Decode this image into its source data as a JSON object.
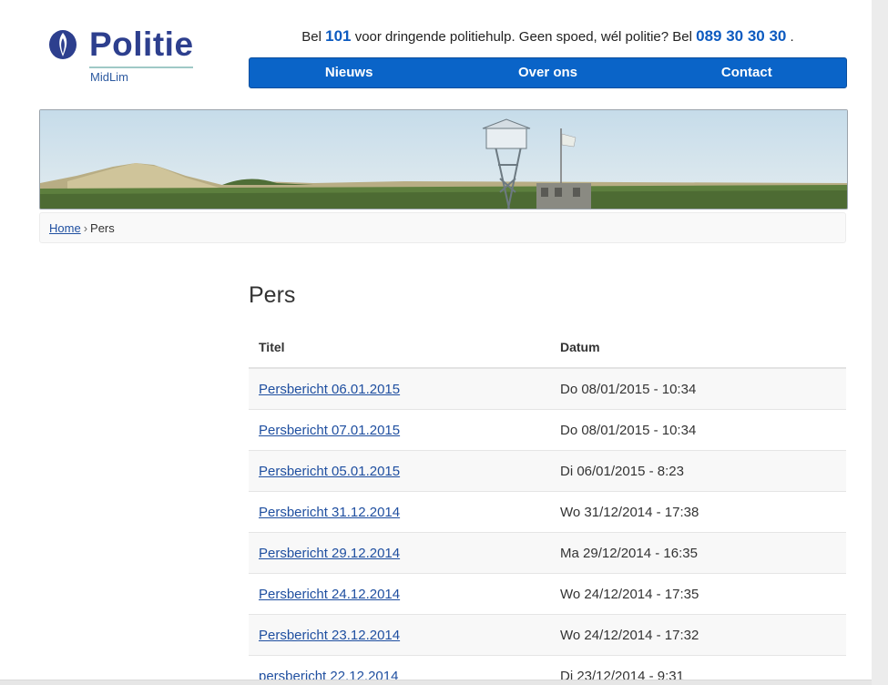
{
  "header": {
    "logo_word": "Politie",
    "logo_sub": "MidLim",
    "tagline_1": "Bel",
    "emergency_number": "101",
    "tagline_2": "voor dringende politiehulp. Geen spoed, wél politie? Bel",
    "office_number": "089 30 30 30",
    "tagline_3": "."
  },
  "nav": {
    "items": [
      "Nieuws",
      "Over ons",
      "Contact"
    ]
  },
  "breadcrumb": {
    "home": "Home",
    "separator": "›",
    "current": "Pers"
  },
  "page_title": "Pers",
  "table": {
    "headers": [
      "Titel",
      "Datum"
    ],
    "rows": [
      {
        "title": "Persbericht 06.01.2015",
        "date": "Do 08/01/2015 - 10:34"
      },
      {
        "title": "Persbericht 07.01.2015",
        "date": "Do 08/01/2015 - 10:34"
      },
      {
        "title": "Persbericht 05.01.2015",
        "date": "Di 06/01/2015 - 8:23"
      },
      {
        "title": "Persbericht 31.12.2014",
        "date": "Wo 31/12/2014 - 17:38"
      },
      {
        "title": "Persbericht 29.12.2014",
        "date": "Ma 29/12/2014 - 16:35"
      },
      {
        "title": "Persbericht 24.12.2014",
        "date": "Wo 24/12/2014 - 17:35"
      },
      {
        "title": "Persbericht 23.12.2014",
        "date": "Wo 24/12/2014 - 17:32"
      },
      {
        "title": "persbericht 22.12.2014",
        "date": "Di 23/12/2014 - 9:31"
      }
    ]
  },
  "colors": {
    "brand": "#2d3f8e",
    "nav": "#0a64c8",
    "link": "#1f4fa0"
  }
}
